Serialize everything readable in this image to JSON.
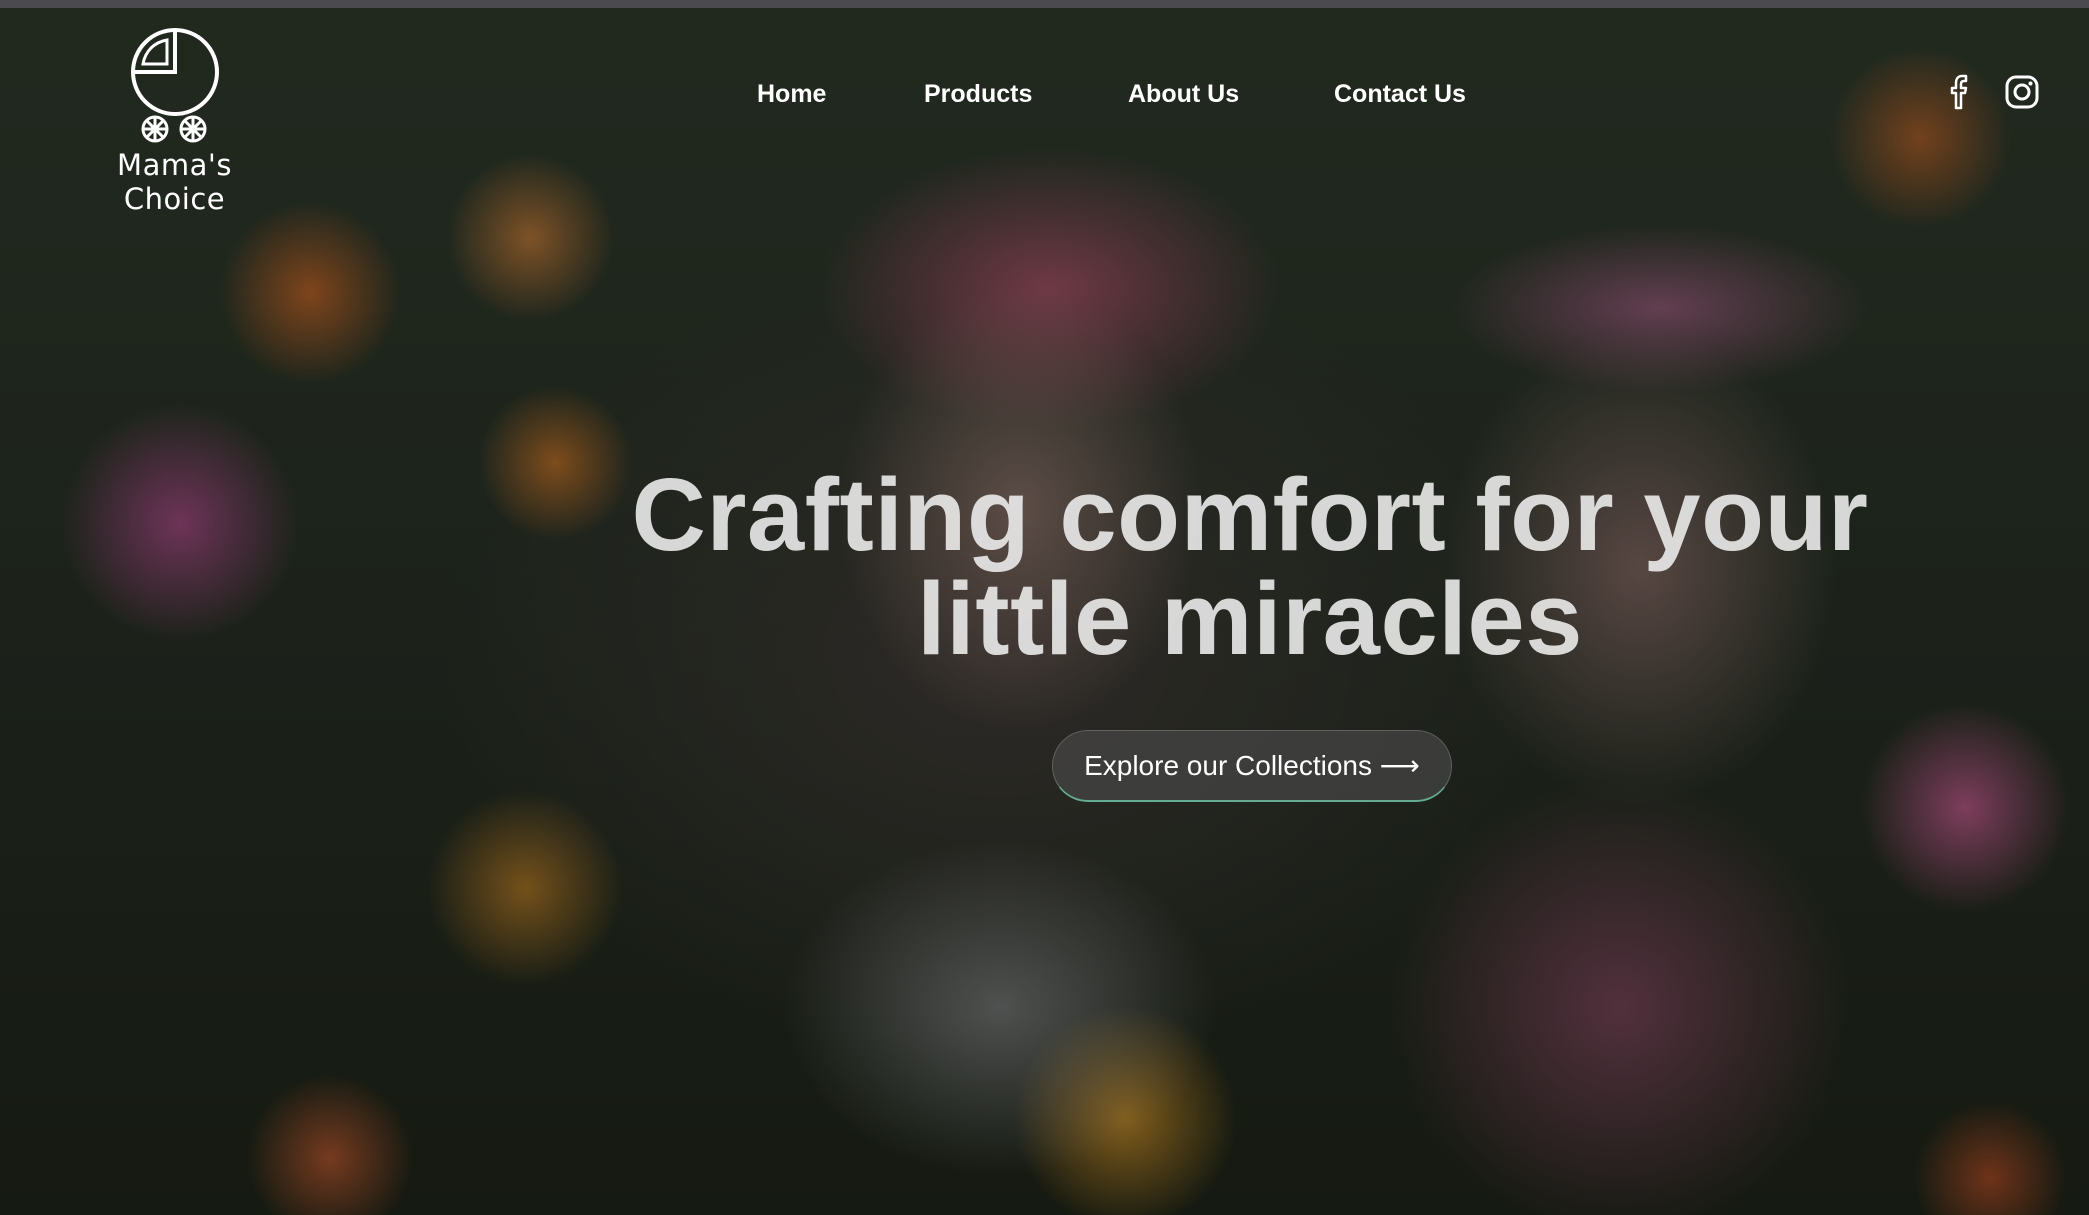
{
  "brand": {
    "name": "Mama's Choice",
    "logo_icon": "stroller-icon"
  },
  "nav": {
    "items": [
      {
        "label": "Home"
      },
      {
        "label": "Products"
      },
      {
        "label": "About Us"
      },
      {
        "label": "Contact Us"
      }
    ]
  },
  "social": {
    "icons": [
      "facebook-icon",
      "instagram-icon"
    ]
  },
  "hero": {
    "headline_line1": "Crafting comfort for your",
    "headline_line2": "little miracles",
    "cta_label": "Explore our Collections ⟶"
  },
  "colors": {
    "text": "#ffffff",
    "cta_accent": "#6ec8aa",
    "cta_background": "#464646"
  }
}
